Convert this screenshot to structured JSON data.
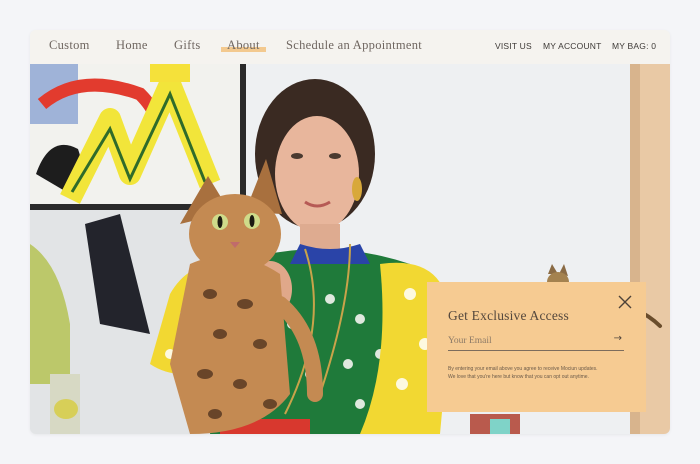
{
  "nav": {
    "main_links": [
      {
        "label": "Custom"
      },
      {
        "label": "Home"
      },
      {
        "label": "Gifts"
      },
      {
        "label": "About",
        "active": true
      },
      {
        "label": "Schedule an Appointment"
      }
    ],
    "utility_links": [
      {
        "label": "VISIT US"
      },
      {
        "label": "MY ACCOUNT"
      },
      {
        "label": "MY BAG: 0"
      }
    ],
    "active_highlight_color": "#f3c98f"
  },
  "hero": {
    "subject": "woman in colorful print dress holding bengal cat",
    "second_cat": "bengal cat sitting on popup"
  },
  "popup": {
    "title": "Get Exclusive Access",
    "email_placeholder": "Your Email",
    "submit_icon": "arrow-right-icon",
    "disclaimer_line1": "By entering your email above you agree to receive Mociun updates.",
    "disclaimer_line2": "We love that you're here but know that you can opt out anytime.",
    "close_icon": "close-icon",
    "background_color": "#f6cb92"
  }
}
